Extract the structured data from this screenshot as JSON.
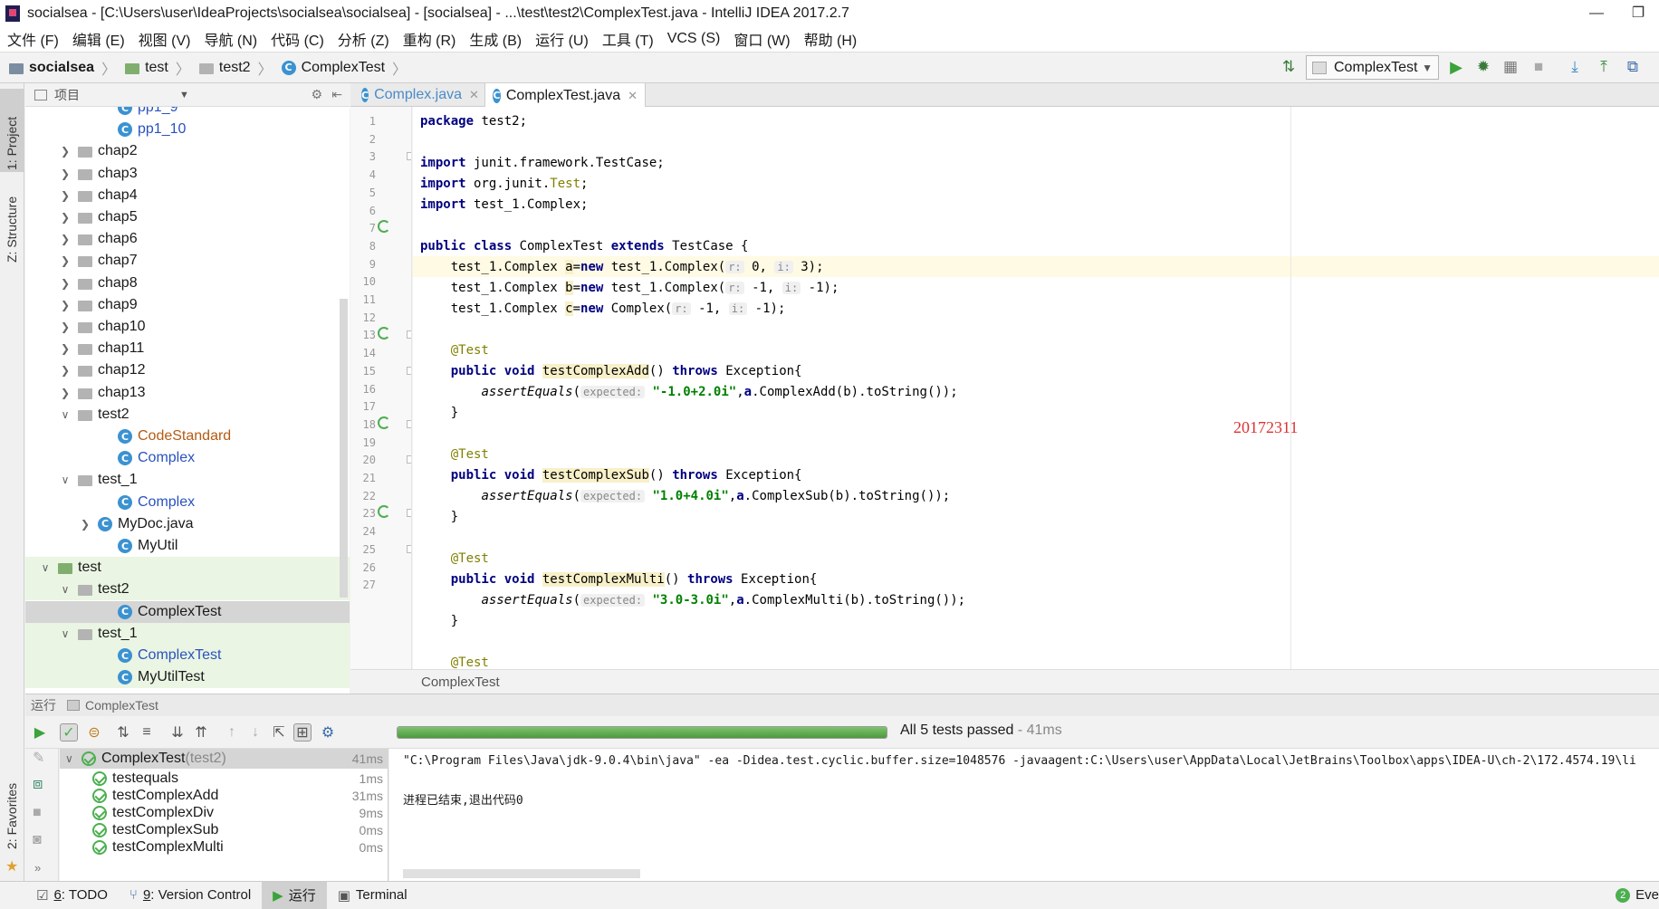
{
  "window": {
    "title": "socialsea - [C:\\Users\\user\\IdeaProjects\\socialsea\\socialsea] - [socialsea] - ...\\test\\test2\\ComplexTest.java - IntelliJ IDEA 2017.2.7",
    "min": "—",
    "restore": "❐"
  },
  "menu": [
    "文件 (F)",
    "编辑 (E)",
    "视图 (V)",
    "导航 (N)",
    "代码 (C)",
    "分析 (Z)",
    "重构 (R)",
    "生成 (B)",
    "运行 (U)",
    "工具 (T)",
    "VCS (S)",
    "窗口 (W)",
    "帮助 (H)"
  ],
  "breadcrumb": [
    "socialsea",
    "test",
    "test2",
    "ComplexTest"
  ],
  "run_config": "ComplexTest",
  "left_tabs": {
    "project": "1: Project",
    "structure": "Z: Structure",
    "favorites": "2: Favorites"
  },
  "project_panel": {
    "title": "项目"
  },
  "tree": [
    {
      "label": "pp1_9",
      "kind": "class",
      "color": "blue"
    },
    {
      "label": "pp1_10",
      "kind": "class",
      "color": "blue"
    },
    {
      "label": "chap2",
      "kind": "pkg"
    },
    {
      "label": "chap3",
      "kind": "pkg"
    },
    {
      "label": "chap4",
      "kind": "pkg"
    },
    {
      "label": "chap5",
      "kind": "pkg"
    },
    {
      "label": "chap6",
      "kind": "pkg"
    },
    {
      "label": "chap7",
      "kind": "pkg"
    },
    {
      "label": "chap8",
      "kind": "pkg"
    },
    {
      "label": "chap9",
      "kind": "pkg"
    },
    {
      "label": "chap10",
      "kind": "pkg"
    },
    {
      "label": "chap11",
      "kind": "pkg"
    },
    {
      "label": "chap12",
      "kind": "pkg"
    },
    {
      "label": "chap13",
      "kind": "pkg"
    },
    {
      "label": "test2",
      "kind": "pkg-open"
    },
    {
      "label": "CodeStandard",
      "kind": "class",
      "color": "orange"
    },
    {
      "label": "Complex",
      "kind": "class",
      "color": "blue"
    },
    {
      "label": "test_1",
      "kind": "pkg-open"
    },
    {
      "label": "Complex",
      "kind": "class",
      "color": "blue"
    },
    {
      "label": "MyDoc.java",
      "kind": "file"
    },
    {
      "label": "MyUtil",
      "kind": "class"
    },
    {
      "label": "test",
      "kind": "testroot"
    },
    {
      "label": "test2",
      "kind": "pkg-open-green"
    },
    {
      "label": "ComplexTest",
      "kind": "class-sel"
    },
    {
      "label": "test_1",
      "kind": "pkg-open-green"
    },
    {
      "label": "ComplexTest",
      "kind": "class-green",
      "color": "blue"
    },
    {
      "label": "MyUtilTest",
      "kind": "class-green"
    }
  ],
  "editor_tabs": [
    {
      "label": "Complex.java",
      "active": false
    },
    {
      "label": "ComplexTest.java",
      "active": true
    }
  ],
  "line_numbers": [
    "1",
    "2",
    "3",
    "4",
    "5",
    "6",
    "7",
    "8",
    "9",
    "10",
    "11",
    "12",
    "13",
    "14",
    "15",
    "16",
    "17",
    "18",
    "19",
    "20",
    "21",
    "22",
    "23",
    "24",
    "25",
    "26",
    "27"
  ],
  "code": {
    "l1": {
      "kw": "package",
      "rest": " test2;"
    },
    "l3": {
      "kw": "import",
      "rest": " junit.framework.TestCase;"
    },
    "l4": {
      "kw": "import",
      "a": " org.junit.",
      "b": "Test",
      "c": ";"
    },
    "l5": {
      "kw": "import",
      "rest": " test_1.Complex;"
    },
    "l7": {
      "k1": "public class",
      "a": " ComplexTest ",
      "k2": "extends",
      "b": " TestCase {"
    },
    "l8": {
      "a": "    test_1.Complex ",
      "v": "a",
      "eq": "=",
      "k": "new",
      "b": " test_1.Complex(",
      "h1": "r:",
      "b2": " 0, ",
      "h2": "i:",
      "b3": " 3);"
    },
    "l9": {
      "a": "    test_1.Complex ",
      "v": "b",
      "eq": "=",
      "k": "new",
      "b": " test_1.Complex(",
      "h1": "r:",
      "b2": " -1, ",
      "h2": "i:",
      "b3": " -1);"
    },
    "l10": {
      "a": "    test_1.Complex ",
      "v": "c",
      "eq": "=",
      "k": "new",
      "b": " Complex(",
      "h1": "r:",
      "b2": " -1, ",
      "h2": "i:",
      "b3": " -1);"
    },
    "l12": {
      "ann": "    @Test"
    },
    "l13": {
      "k1": "    public void",
      "sp": " ",
      "m": "testComplexAdd",
      "a": "() ",
      "k2": "throws",
      "b": " Exception{"
    },
    "l14": {
      "a": "        ",
      "m": "assertEquals",
      "b": "(",
      "h": "expected:",
      "s": " \"-1.0+2.0i\"",
      "c": ",",
      "v": "a",
      "d": ".ComplexAdd(b).toString());"
    },
    "l15": {
      "a": "    }"
    },
    "l17": {
      "ann": "    @Test"
    },
    "l18": {
      "k1": "    public void",
      "sp": " ",
      "m": "testComplexSub",
      "a": "() ",
      "k2": "throws",
      "b": " Exception{"
    },
    "l19": {
      "a": "        ",
      "m": "assertEquals",
      "b": "(",
      "h": "expected:",
      "s": " \"1.0+4.0i\"",
      "c": ",",
      "v": "a",
      "d": ".ComplexSub(b).toString());"
    },
    "l20": {
      "a": "    }"
    },
    "l22": {
      "ann": "    @Test"
    },
    "l23": {
      "k1": "    public void",
      "sp": " ",
      "m": "testComplexMulti",
      "a": "() ",
      "k2": "throws",
      "b": " Exception{"
    },
    "l24": {
      "a": "        ",
      "m": "assertEquals",
      "b": "(",
      "h": "expected:",
      "s": " \"3.0-3.0i\"",
      "c": ",",
      "v": "a",
      "d": ".ComplexMulti(b).toString());"
    },
    "l25": {
      "a": "    }"
    },
    "l27": {
      "ann": "    @Test"
    }
  },
  "watermark": "20172311",
  "editor_footer": "ComplexTest",
  "run_panel": {
    "tab": "运行",
    "name": "ComplexTest"
  },
  "tests": {
    "progress": 1.0,
    "status": "All 5 tests passed",
    "status_time": " - 41ms",
    "root": {
      "name": "ComplexTest",
      "pkg": " (test2)",
      "time": "41ms"
    },
    "items": [
      {
        "name": "testequals",
        "time": "1ms"
      },
      {
        "name": "testComplexAdd",
        "time": "31ms"
      },
      {
        "name": "testComplexDiv",
        "time": "9ms"
      },
      {
        "name": "testComplexSub",
        "time": "0ms"
      },
      {
        "name": "testComplexMulti",
        "time": "0ms"
      }
    ]
  },
  "console": {
    "line1": "\"C:\\Program Files\\Java\\jdk-9.0.4\\bin\\java\" -ea -Didea.test.cyclic.buffer.size=1048576 -javaagent:C:\\Users\\user\\AppData\\Local\\JetBrains\\Toolbox\\apps\\IDEA-U\\ch-2\\172.4574.19\\li",
    "line2": "进程已结束,退出代码0"
  },
  "statusbar": {
    "todo_num": "6",
    "todo": ": TODO",
    "vc_num": "9",
    "vc": ": Version Control",
    "run": "运行",
    "terminal": "Terminal",
    "events_count": "2",
    "events": "Eve"
  },
  "colors": {
    "accent_green": "#4caf50",
    "keyword": "#000080",
    "annotation": "#808000",
    "string": "#008000",
    "watermark": "#dd3333"
  }
}
